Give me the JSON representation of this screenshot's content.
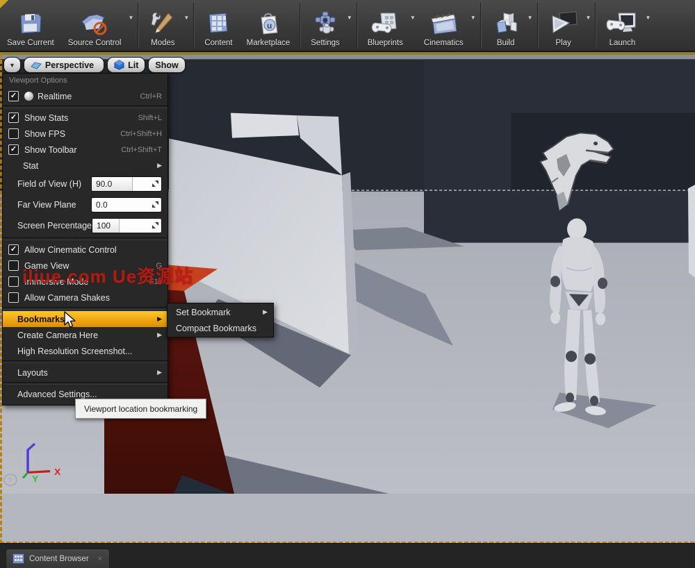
{
  "toolbar": {
    "items": [
      {
        "label": "Save Current",
        "icon": "save-icon",
        "caret": false
      },
      {
        "label": "Source Control",
        "icon": "source-control-icon",
        "caret": true
      },
      {
        "label": "Modes",
        "icon": "modes-icon",
        "caret": true
      },
      {
        "label": "Content",
        "icon": "content-icon",
        "caret": false
      },
      {
        "label": "Marketplace",
        "icon": "marketplace-icon",
        "caret": false
      },
      {
        "label": "Settings",
        "icon": "settings-icon",
        "caret": true
      },
      {
        "label": "Blueprints",
        "icon": "blueprints-icon",
        "caret": true
      },
      {
        "label": "Cinematics",
        "icon": "cinematics-icon",
        "caret": true
      },
      {
        "label": "Build",
        "icon": "build-icon",
        "caret": true
      },
      {
        "label": "Play",
        "icon": "play-icon",
        "caret": true
      },
      {
        "label": "Launch",
        "icon": "launch-icon",
        "caret": true
      }
    ]
  },
  "viewport_bar": {
    "perspective": "Perspective",
    "lit": "Lit",
    "show": "Show"
  },
  "menu": {
    "header": "Viewport Options",
    "items": [
      {
        "label": "Realtime",
        "shortcut": "Ctrl+R",
        "checked": true
      },
      {
        "label": "Show Stats",
        "shortcut": "Shift+L",
        "checked": true
      },
      {
        "label": "Show FPS",
        "shortcut": "Ctrl+Shift+H",
        "checked": false
      },
      {
        "label": "Show Toolbar",
        "shortcut": "Ctrl+Shift+T",
        "checked": true
      },
      {
        "label": "Stat"
      },
      {
        "label": "Field of View (H)",
        "value": "90.0"
      },
      {
        "label": "Far View Plane",
        "value": "0.0"
      },
      {
        "label": "Screen Percentage",
        "value": "100"
      },
      {
        "label": "Allow Cinematic Control",
        "checked": true
      },
      {
        "label": "Game View",
        "shortcut": "G",
        "checked": false
      },
      {
        "label": "Immersive Mode",
        "shortcut": "F11",
        "checked": false
      },
      {
        "label": "Allow Camera Shakes",
        "checked": false
      },
      {
        "label": "Bookmarks",
        "highlighted": true
      },
      {
        "label": "Create Camera Here"
      },
      {
        "label": "High Resolution Screenshot..."
      },
      {
        "label": "Layouts"
      },
      {
        "label": "Advanced Settings..."
      }
    ]
  },
  "submenu": {
    "items": [
      {
        "label": "Set Bookmark",
        "arrow": true
      },
      {
        "label": "Compact Bookmarks",
        "arrow": false
      }
    ]
  },
  "tooltip": {
    "text": "Viewport location bookmarking"
  },
  "watermark": {
    "text": "iliue.com  Ue资源站"
  },
  "gizmo": {
    "x_label": "X",
    "y_label": "Y",
    "help_glyph": "?"
  },
  "bottom": {
    "tab_label": "Content Browser",
    "tab_icon": "content-browser-icon",
    "close_glyph": "×"
  },
  "glyphs": {
    "caret": "▼",
    "arrow": "▶",
    "check": "✓"
  },
  "colors": {
    "menu_highlight": "#f0a000",
    "viewport_border": "#b5821b",
    "wall": "#262a33",
    "floor": "#b4b7be",
    "red_cube_top": "#c6401f",
    "red_cube_front": "#4a130d",
    "watermark_red": "#bb1c12"
  }
}
